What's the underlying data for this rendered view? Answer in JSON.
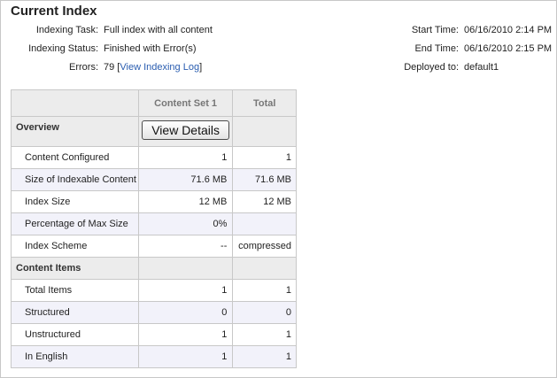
{
  "header": {
    "title": "Current Index"
  },
  "info_left": [
    {
      "label": "Indexing Task:",
      "value": "Full index with all content"
    },
    {
      "label": "Indexing Status:",
      "value": "Finished with Error(s)"
    },
    {
      "label": "Errors:",
      "count": "79",
      "link": "View Indexing Log"
    }
  ],
  "info_right": [
    {
      "label": "Start Time:",
      "value": "06/16/2010 2:14 PM"
    },
    {
      "label": "End Time:",
      "value": "06/16/2010 2:15 PM"
    },
    {
      "label": "Deployed to:",
      "value": "default1"
    }
  ],
  "table": {
    "columns": [
      "",
      "Content Set 1",
      "Total"
    ],
    "overview_label": "Overview",
    "view_details_label": "View Details",
    "overview_rows": [
      {
        "label": "Content Configured",
        "set1": "1",
        "total": "1"
      },
      {
        "label": "Size of Indexable Content",
        "set1": "71.6 MB",
        "total": "71.6 MB"
      },
      {
        "label": "Index Size",
        "set1": "12 MB",
        "total": "12 MB"
      },
      {
        "label": "Percentage of Max Size",
        "set1": "0%",
        "total": ""
      },
      {
        "label": "Index Scheme",
        "set1": "--",
        "total": "compressed"
      }
    ],
    "items_label": "Content Items",
    "items_rows": [
      {
        "label": "Total Items",
        "set1": "1",
        "total": "1"
      },
      {
        "label": "Structured",
        "set1": "0",
        "total": "0"
      },
      {
        "label": "Unstructured",
        "set1": "1",
        "total": "1"
      },
      {
        "label": "In English",
        "set1": "1",
        "total": "1"
      }
    ]
  }
}
